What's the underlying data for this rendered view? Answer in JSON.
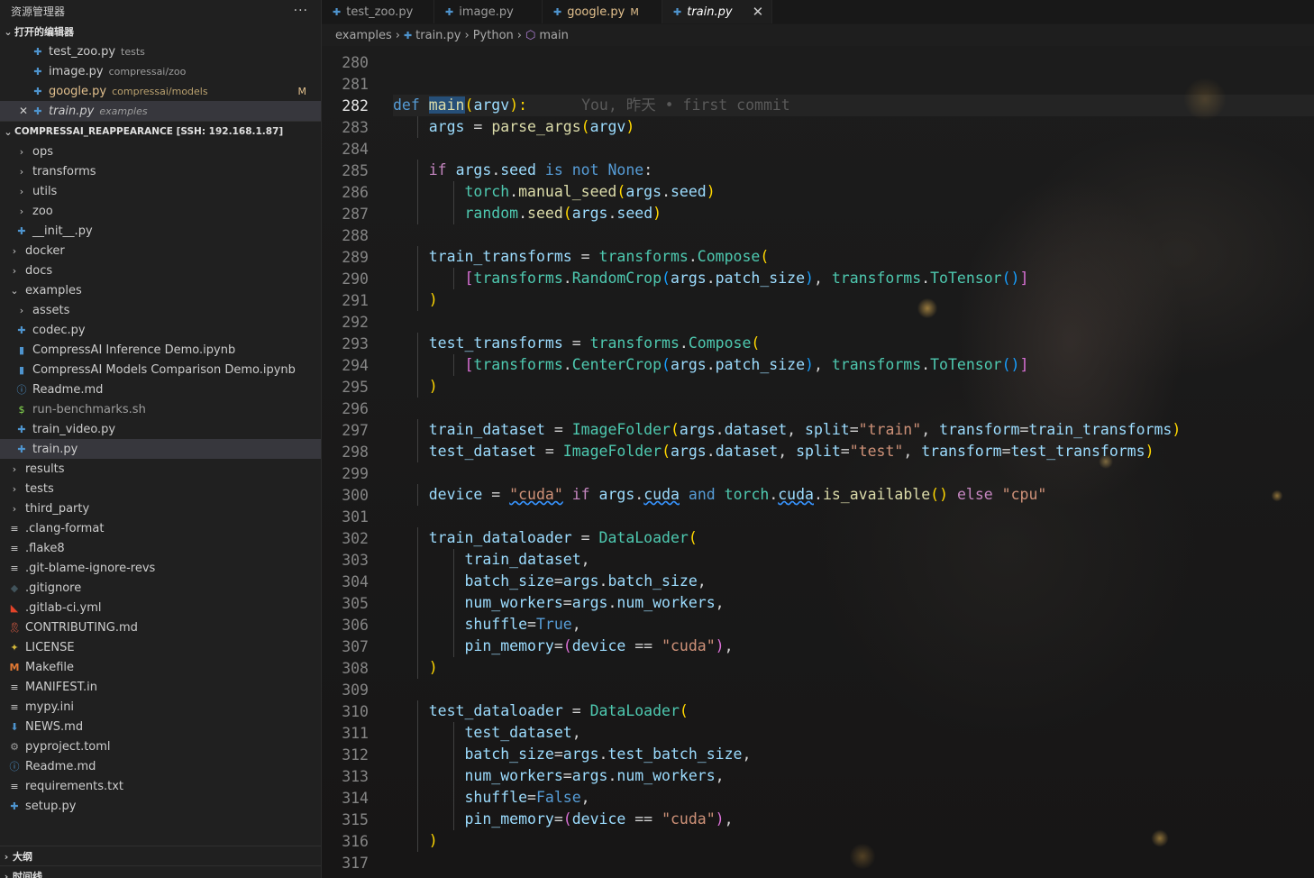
{
  "explorer": {
    "title": "资源管理器",
    "more_label": "···",
    "open_editors_label": "打开的编辑器",
    "open_editors": [
      {
        "name": "test_zoo.py",
        "desc": "tests",
        "modified": false,
        "close": ""
      },
      {
        "name": "image.py",
        "desc": "compressai/zoo",
        "modified": false,
        "close": ""
      },
      {
        "name": "google.py",
        "desc": "compressai/models",
        "modified": true,
        "badge": "M",
        "close": ""
      },
      {
        "name": "train.py",
        "desc": "examples",
        "modified": false,
        "close": "✕"
      }
    ],
    "project_label": "COMPRESSAI_REAPPEARANCE [SSH: 192.168.1.87]",
    "tree": [
      {
        "name": "ops",
        "type": "folder",
        "level": 1
      },
      {
        "name": "transforms",
        "type": "folder",
        "level": 1
      },
      {
        "name": "utils",
        "type": "folder",
        "level": 1
      },
      {
        "name": "zoo",
        "type": "folder",
        "level": 1
      },
      {
        "name": "__init__.py",
        "type": "python",
        "level": 1
      },
      {
        "name": "docker",
        "type": "folder",
        "level": 0
      },
      {
        "name": "docs",
        "type": "folder",
        "level": 0
      },
      {
        "name": "examples",
        "type": "folder-open",
        "level": 0
      },
      {
        "name": "assets",
        "type": "folder",
        "level": 1
      },
      {
        "name": "codec.py",
        "type": "python",
        "level": 1
      },
      {
        "name": "CompressAI Inference Demo.ipynb",
        "type": "notebook",
        "level": 1
      },
      {
        "name": "CompressAI Models Comparison Demo.ipynb",
        "type": "notebook",
        "level": 1
      },
      {
        "name": "Readme.md",
        "type": "info",
        "level": 1
      },
      {
        "name": "run-benchmarks.sh",
        "type": "shell",
        "level": 1
      },
      {
        "name": "train_video.py",
        "type": "python",
        "level": 1
      },
      {
        "name": "train.py",
        "type": "python",
        "level": 1,
        "selected": true
      },
      {
        "name": "results",
        "type": "folder",
        "level": 0
      },
      {
        "name": "tests",
        "type": "folder",
        "level": 0
      },
      {
        "name": "third_party",
        "type": "folder",
        "level": 0
      },
      {
        "name": ".clang-format",
        "type": "text",
        "level": 0
      },
      {
        "name": ".flake8",
        "type": "text",
        "level": 0
      },
      {
        "name": ".git-blame-ignore-revs",
        "type": "text",
        "level": 0
      },
      {
        "name": ".gitignore",
        "type": "git",
        "level": 0
      },
      {
        "name": ".gitlab-ci.yml",
        "type": "gitlab",
        "level": 0
      },
      {
        "name": "CONTRIBUTING.md",
        "type": "ribbon",
        "level": 0
      },
      {
        "name": "LICENSE",
        "type": "license",
        "level": 0
      },
      {
        "name": "Makefile",
        "type": "makefile",
        "level": 0
      },
      {
        "name": "MANIFEST.in",
        "type": "text",
        "level": 0
      },
      {
        "name": "mypy.ini",
        "type": "text",
        "level": 0
      },
      {
        "name": "NEWS.md",
        "type": "news",
        "level": 0
      },
      {
        "name": "pyproject.toml",
        "type": "gear",
        "level": 0
      },
      {
        "name": "Readme.md",
        "type": "info",
        "level": 0
      },
      {
        "name": "requirements.txt",
        "type": "text",
        "level": 0
      },
      {
        "name": "setup.py",
        "type": "python",
        "level": 0
      }
    ],
    "outline_label": "大纲",
    "timeline_label": "时间线"
  },
  "tabs": [
    {
      "name": "test_zoo.py",
      "flag": "",
      "active": false,
      "modified": false
    },
    {
      "name": "image.py",
      "flag": "",
      "active": false,
      "modified": false
    },
    {
      "name": "google.py",
      "flag": "M",
      "active": false,
      "modified": true
    },
    {
      "name": "train.py",
      "flag": "",
      "active": true,
      "modified": false,
      "close": "✕"
    }
  ],
  "breadcrumb": {
    "folder": "examples",
    "file": "train.py",
    "lang": "Python",
    "symbol": "main",
    "sep": "›"
  },
  "editor": {
    "current_line": 282,
    "blame": "You, 昨天 • first commit",
    "lines": [
      {
        "n": 280,
        "indent": 0,
        "tokens": []
      },
      {
        "n": 281,
        "indent": 0,
        "tokens": []
      },
      {
        "n": 282,
        "indent": 0,
        "tokens": [
          [
            "k",
            "def "
          ],
          [
            "fh",
            "main"
          ],
          [
            "p",
            "("
          ],
          [
            "v",
            "argv"
          ],
          [
            "p",
            "):"
          ]
        ]
      },
      {
        "n": 283,
        "indent": 1,
        "tokens": [
          [
            "v",
            "args"
          ],
          [
            "o",
            " = "
          ],
          [
            "f",
            "parse_args"
          ],
          [
            "p",
            "("
          ],
          [
            "v",
            "argv"
          ],
          [
            "p",
            ")"
          ]
        ]
      },
      {
        "n": 284,
        "indent": 0,
        "tokens": []
      },
      {
        "n": 285,
        "indent": 1,
        "tokens": [
          [
            "c",
            "if "
          ],
          [
            "v",
            "args"
          ],
          [
            "o",
            "."
          ],
          [
            "v",
            "seed"
          ],
          [
            "k",
            " is not "
          ],
          [
            "k",
            "None"
          ],
          [
            "o",
            ":"
          ]
        ]
      },
      {
        "n": 286,
        "indent": 2,
        "tokens": [
          [
            "t",
            "torch"
          ],
          [
            "o",
            "."
          ],
          [
            "f",
            "manual_seed"
          ],
          [
            "p",
            "("
          ],
          [
            "v",
            "args"
          ],
          [
            "o",
            "."
          ],
          [
            "v",
            "seed"
          ],
          [
            "p",
            ")"
          ]
        ]
      },
      {
        "n": 287,
        "indent": 2,
        "tokens": [
          [
            "t",
            "random"
          ],
          [
            "o",
            "."
          ],
          [
            "f",
            "seed"
          ],
          [
            "p",
            "("
          ],
          [
            "v",
            "args"
          ],
          [
            "o",
            "."
          ],
          [
            "v",
            "seed"
          ],
          [
            "p",
            ")"
          ]
        ]
      },
      {
        "n": 288,
        "indent": 0,
        "tokens": []
      },
      {
        "n": 289,
        "indent": 1,
        "tokens": [
          [
            "v",
            "train_transforms"
          ],
          [
            "o",
            " = "
          ],
          [
            "t",
            "transforms"
          ],
          [
            "o",
            "."
          ],
          [
            "t",
            "Compose"
          ],
          [
            "p",
            "("
          ]
        ]
      },
      {
        "n": 290,
        "indent": 2,
        "tokens": [
          [
            "p2",
            "["
          ],
          [
            "t",
            "transforms"
          ],
          [
            "o",
            "."
          ],
          [
            "t",
            "RandomCrop"
          ],
          [
            "p3",
            "("
          ],
          [
            "v",
            "args"
          ],
          [
            "o",
            "."
          ],
          [
            "v",
            "patch_size"
          ],
          [
            "p3",
            ")"
          ],
          [
            "o",
            ", "
          ],
          [
            "t",
            "transforms"
          ],
          [
            "o",
            "."
          ],
          [
            "t",
            "ToTensor"
          ],
          [
            "p3",
            "()"
          ],
          [
            "p2",
            "]"
          ]
        ]
      },
      {
        "n": 291,
        "indent": 1,
        "tokens": [
          [
            "p",
            ")"
          ]
        ]
      },
      {
        "n": 292,
        "indent": 0,
        "tokens": []
      },
      {
        "n": 293,
        "indent": 1,
        "tokens": [
          [
            "v",
            "test_transforms"
          ],
          [
            "o",
            " = "
          ],
          [
            "t",
            "transforms"
          ],
          [
            "o",
            "."
          ],
          [
            "t",
            "Compose"
          ],
          [
            "p",
            "("
          ]
        ]
      },
      {
        "n": 294,
        "indent": 2,
        "tokens": [
          [
            "p2",
            "["
          ],
          [
            "t",
            "transforms"
          ],
          [
            "o",
            "."
          ],
          [
            "t",
            "CenterCrop"
          ],
          [
            "p3",
            "("
          ],
          [
            "v",
            "args"
          ],
          [
            "o",
            "."
          ],
          [
            "v",
            "patch_size"
          ],
          [
            "p3",
            ")"
          ],
          [
            "o",
            ", "
          ],
          [
            "t",
            "transforms"
          ],
          [
            "o",
            "."
          ],
          [
            "t",
            "ToTensor"
          ],
          [
            "p3",
            "()"
          ],
          [
            "p2",
            "]"
          ]
        ]
      },
      {
        "n": 295,
        "indent": 1,
        "tokens": [
          [
            "p",
            ")"
          ]
        ]
      },
      {
        "n": 296,
        "indent": 0,
        "tokens": []
      },
      {
        "n": 297,
        "indent": 1,
        "tokens": [
          [
            "v",
            "train_dataset"
          ],
          [
            "o",
            " = "
          ],
          [
            "t",
            "ImageFolder"
          ],
          [
            "p",
            "("
          ],
          [
            "v",
            "args"
          ],
          [
            "o",
            "."
          ],
          [
            "v",
            "dataset"
          ],
          [
            "o",
            ", "
          ],
          [
            "v",
            "split"
          ],
          [
            "o",
            "="
          ],
          [
            "s",
            "\"train\""
          ],
          [
            "o",
            ", "
          ],
          [
            "v",
            "transform"
          ],
          [
            "o",
            "="
          ],
          [
            "v",
            "train_transforms"
          ],
          [
            "p",
            ")"
          ]
        ]
      },
      {
        "n": 298,
        "indent": 1,
        "tokens": [
          [
            "v",
            "test_dataset"
          ],
          [
            "o",
            " = "
          ],
          [
            "t",
            "ImageFolder"
          ],
          [
            "p",
            "("
          ],
          [
            "v",
            "args"
          ],
          [
            "o",
            "."
          ],
          [
            "v",
            "dataset"
          ],
          [
            "o",
            ", "
          ],
          [
            "v",
            "split"
          ],
          [
            "o",
            "="
          ],
          [
            "s",
            "\"test\""
          ],
          [
            "o",
            ", "
          ],
          [
            "v",
            "transform"
          ],
          [
            "o",
            "="
          ],
          [
            "v",
            "test_transforms"
          ],
          [
            "p",
            ")"
          ]
        ]
      },
      {
        "n": 299,
        "indent": 0,
        "tokens": []
      },
      {
        "n": 300,
        "indent": 1,
        "tokens": [
          [
            "v",
            "device"
          ],
          [
            "o",
            " = "
          ],
          [
            "sq",
            "\"cuda\""
          ],
          [
            "c",
            " if "
          ],
          [
            "v",
            "args"
          ],
          [
            "o",
            "."
          ],
          [
            "vsq",
            "cuda"
          ],
          [
            "k",
            " and "
          ],
          [
            "t",
            "torch"
          ],
          [
            "o",
            "."
          ],
          [
            "vsq",
            "cuda"
          ],
          [
            "o",
            "."
          ],
          [
            "f",
            "is_available"
          ],
          [
            "p",
            "()"
          ],
          [
            "c",
            " else "
          ],
          [
            "s",
            "\"cpu\""
          ]
        ]
      },
      {
        "n": 301,
        "indent": 0,
        "tokens": []
      },
      {
        "n": 302,
        "indent": 1,
        "tokens": [
          [
            "v",
            "train_dataloader"
          ],
          [
            "o",
            " = "
          ],
          [
            "t",
            "DataLoader"
          ],
          [
            "p",
            "("
          ]
        ]
      },
      {
        "n": 303,
        "indent": 2,
        "tokens": [
          [
            "v",
            "train_dataset"
          ],
          [
            "o",
            ","
          ]
        ]
      },
      {
        "n": 304,
        "indent": 2,
        "tokens": [
          [
            "v",
            "batch_size"
          ],
          [
            "o",
            "="
          ],
          [
            "v",
            "args"
          ],
          [
            "o",
            "."
          ],
          [
            "v",
            "batch_size"
          ],
          [
            "o",
            ","
          ]
        ]
      },
      {
        "n": 305,
        "indent": 2,
        "tokens": [
          [
            "v",
            "num_workers"
          ],
          [
            "o",
            "="
          ],
          [
            "v",
            "args"
          ],
          [
            "o",
            "."
          ],
          [
            "v",
            "num_workers"
          ],
          [
            "o",
            ","
          ]
        ]
      },
      {
        "n": 306,
        "indent": 2,
        "tokens": [
          [
            "v",
            "shuffle"
          ],
          [
            "o",
            "="
          ],
          [
            "k",
            "True"
          ],
          [
            "o",
            ","
          ]
        ]
      },
      {
        "n": 307,
        "indent": 2,
        "tokens": [
          [
            "v",
            "pin_memory"
          ],
          [
            "o",
            "="
          ],
          [
            "p2",
            "("
          ],
          [
            "v",
            "device"
          ],
          [
            "o",
            " == "
          ],
          [
            "s",
            "\"cuda\""
          ],
          [
            "p2",
            ")"
          ],
          [
            "o",
            ","
          ]
        ]
      },
      {
        "n": 308,
        "indent": 1,
        "tokens": [
          [
            "p",
            ")"
          ]
        ]
      },
      {
        "n": 309,
        "indent": 0,
        "tokens": []
      },
      {
        "n": 310,
        "indent": 1,
        "tokens": [
          [
            "v",
            "test_dataloader"
          ],
          [
            "o",
            " = "
          ],
          [
            "t",
            "DataLoader"
          ],
          [
            "p",
            "("
          ]
        ]
      },
      {
        "n": 311,
        "indent": 2,
        "tokens": [
          [
            "v",
            "test_dataset"
          ],
          [
            "o",
            ","
          ]
        ]
      },
      {
        "n": 312,
        "indent": 2,
        "tokens": [
          [
            "v",
            "batch_size"
          ],
          [
            "o",
            "="
          ],
          [
            "v",
            "args"
          ],
          [
            "o",
            "."
          ],
          [
            "v",
            "test_batch_size"
          ],
          [
            "o",
            ","
          ]
        ]
      },
      {
        "n": 313,
        "indent": 2,
        "tokens": [
          [
            "v",
            "num_workers"
          ],
          [
            "o",
            "="
          ],
          [
            "v",
            "args"
          ],
          [
            "o",
            "."
          ],
          [
            "v",
            "num_workers"
          ],
          [
            "o",
            ","
          ]
        ]
      },
      {
        "n": 314,
        "indent": 2,
        "tokens": [
          [
            "v",
            "shuffle"
          ],
          [
            "o",
            "="
          ],
          [
            "k",
            "False"
          ],
          [
            "o",
            ","
          ]
        ]
      },
      {
        "n": 315,
        "indent": 2,
        "tokens": [
          [
            "v",
            "pin_memory"
          ],
          [
            "o",
            "="
          ],
          [
            "p2",
            "("
          ],
          [
            "v",
            "device"
          ],
          [
            "o",
            " == "
          ],
          [
            "s",
            "\"cuda\""
          ],
          [
            "p2",
            ")"
          ],
          [
            "o",
            ","
          ]
        ]
      },
      {
        "n": 316,
        "indent": 1,
        "tokens": [
          [
            "p",
            ")"
          ]
        ]
      },
      {
        "n": 317,
        "indent": 0,
        "tokens": []
      }
    ]
  },
  "colors": {
    "keyword": "#569cd6",
    "control": "#c586c0",
    "function": "#dcdcaa",
    "variable": "#9cdcfe",
    "type": "#4ec9b0",
    "string": "#ce9178",
    "modified": "#e2c08d",
    "python_icon": "#4e94ce"
  }
}
